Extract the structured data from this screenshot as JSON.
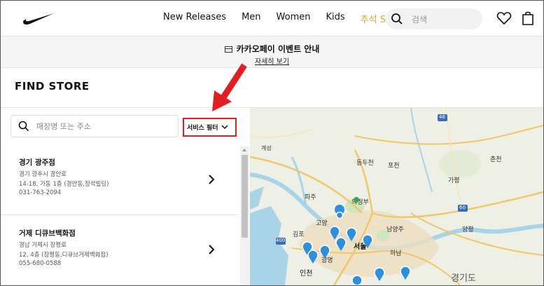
{
  "header": {
    "nav": [
      "New Releases",
      "Men",
      "Women",
      "Kids",
      "추석 SALE"
    ],
    "search_placeholder": "검색"
  },
  "banner": {
    "title": "카카오페이 이벤트 안내",
    "link": "자세히 보기"
  },
  "page": {
    "title": "FIND STORE"
  },
  "store_search": {
    "placeholder": "매장명 또는 주소"
  },
  "filter": {
    "label": "서비스 필터"
  },
  "stores": [
    {
      "name": "경기 광주점",
      "address1": "경기 광주시 경안로",
      "address2": "14-18, 가동 1층 (경안동,정석빌딩)",
      "phone": "031-763-2094"
    },
    {
      "name": "거제 디큐브백화점",
      "address1": "경남 거제시 장평로",
      "address2": "12, 4층 (장평동,디큐브거제백화점)",
      "phone": "055-680-0588"
    }
  ],
  "map": {
    "labels": [
      "개성",
      "동두천",
      "포천",
      "춘천",
      "파주",
      "의정부",
      "가평",
      "고양",
      "남양주",
      "양평",
      "김포",
      "서울",
      "하남",
      "인천",
      "광명",
      "경기도"
    ],
    "road_badges": [
      "46",
      "60",
      "400"
    ]
  },
  "colors": {
    "sale": "#e1a52a",
    "annotation": "#e02020",
    "pin": "#2f8fd8"
  }
}
